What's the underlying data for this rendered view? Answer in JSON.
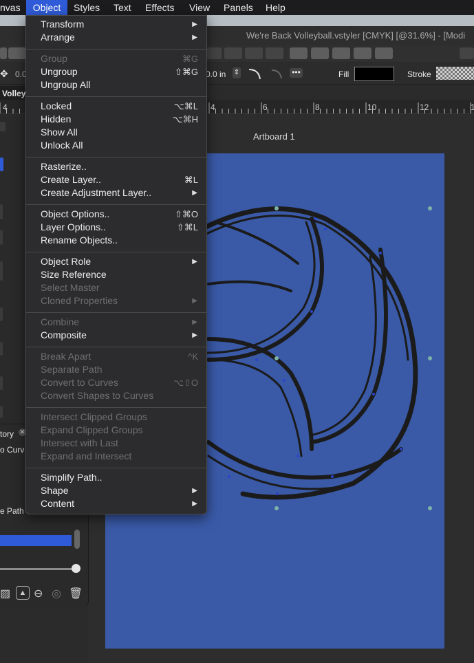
{
  "menubar": {
    "items": [
      "nvas",
      "Object",
      "Styles",
      "Text",
      "Effects",
      "View",
      "Panels",
      "Help"
    ],
    "active": "Object"
  },
  "window": {
    "title": "We're Back Volleyball.vstyler [CMYK] [@31.6%] - [Modi"
  },
  "properties": {
    "x_value": "0.0",
    "y_value": "0.0 in",
    "fill_label": "Fill",
    "stroke_label": "Stroke",
    "fill_color": "#000000"
  },
  "tabs": {
    "active_tab": "Volleyl"
  },
  "ruler": {
    "labels": [
      "4",
      "4",
      "6",
      "8",
      "10",
      "12",
      "1"
    ]
  },
  "canvas": {
    "artboard_label": "Artboard 1",
    "artboard_color": "#3a5aa8"
  },
  "left_panel": {
    "history_tab": "tory",
    "history_item": "o Curv",
    "path_item": "e Path"
  },
  "object_menu": {
    "groups": [
      [
        {
          "label": "Transform",
          "submenu": true
        },
        {
          "label": "Arrange",
          "submenu": true
        }
      ],
      [
        {
          "label": "Group",
          "shortcut": "⌘G",
          "disabled": true
        },
        {
          "label": "Ungroup",
          "shortcut": "⇧⌘G"
        },
        {
          "label": "Ungroup All"
        }
      ],
      [
        {
          "label": "Locked",
          "shortcut": "⌥⌘L"
        },
        {
          "label": "Hidden",
          "shortcut": "⌥⌘H"
        },
        {
          "label": "Show All"
        },
        {
          "label": "Unlock All"
        }
      ],
      [
        {
          "label": "Rasterize.."
        },
        {
          "label": "Create Layer..",
          "shortcut": "⌘L"
        },
        {
          "label": "Create Adjustment Layer..",
          "submenu": true
        }
      ],
      [
        {
          "label": "Object Options..",
          "shortcut": "⇧⌘O"
        },
        {
          "label": "Layer Options..",
          "shortcut": "⇧⌘L"
        },
        {
          "label": "Rename Objects.."
        }
      ],
      [
        {
          "label": "Object Role",
          "submenu": true
        },
        {
          "label": "Size Reference"
        },
        {
          "label": "Select Master",
          "disabled": true
        },
        {
          "label": "Cloned Properties",
          "submenu": true,
          "disabled": true
        }
      ],
      [
        {
          "label": "Combine",
          "submenu": true,
          "disabled": true
        },
        {
          "label": "Composite",
          "submenu": true
        }
      ],
      [
        {
          "label": "Break Apart",
          "shortcut": "^K",
          "disabled": true
        },
        {
          "label": "Separate Path",
          "disabled": true
        },
        {
          "label": "Convert to Curves",
          "shortcut": "⌥⇧O",
          "disabled": true
        },
        {
          "label": "Convert Shapes to Curves",
          "disabled": true
        }
      ],
      [
        {
          "label": "Intersect Clipped Groups",
          "disabled": true
        },
        {
          "label": "Expand Clipped Groups",
          "disabled": true
        },
        {
          "label": "Intersect with Last",
          "disabled": true
        },
        {
          "label": "Expand and Intersect",
          "disabled": true
        }
      ],
      [
        {
          "label": "Simplify Path.."
        },
        {
          "label": "Shape",
          "submenu": true
        },
        {
          "label": "Content",
          "submenu": true
        }
      ]
    ]
  }
}
